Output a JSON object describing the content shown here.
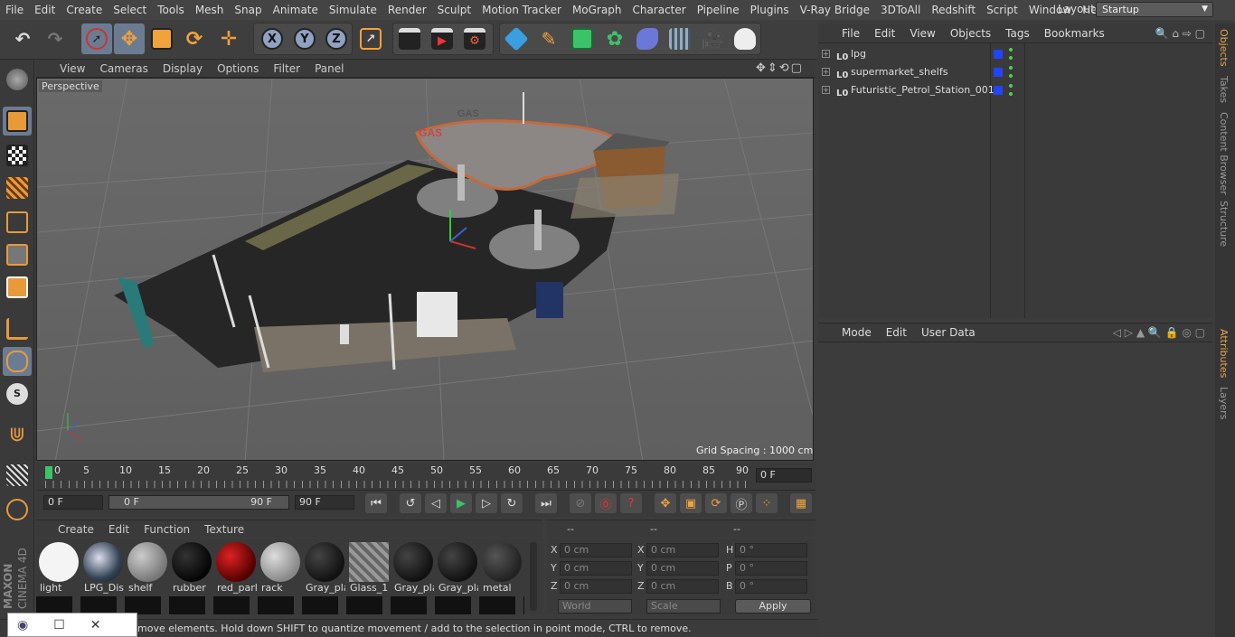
{
  "menubar": {
    "items": [
      "File",
      "Edit",
      "Create",
      "Select",
      "Tools",
      "Mesh",
      "Snap",
      "Animate",
      "Simulate",
      "Render",
      "Sculpt",
      "Motion Tracker",
      "MoGraph",
      "Character",
      "Pipeline",
      "Plugins",
      "V-Ray Bridge",
      "3DToAll",
      "Redshift",
      "Script",
      "Window",
      "Help"
    ],
    "layout_label": "Layout:",
    "layout_value": "Startup"
  },
  "viewport": {
    "menu": [
      "View",
      "Cameras",
      "Display",
      "Options",
      "Filter",
      "Panel"
    ],
    "label": "Perspective",
    "grid_spacing": "Grid Spacing : 1000 cm",
    "scene_text": "GAS"
  },
  "timeline": {
    "ticks": [
      "0",
      "5",
      "10",
      "15",
      "20",
      "25",
      "30",
      "35",
      "40",
      "45",
      "50",
      "55",
      "60",
      "65",
      "70",
      "75",
      "80",
      "85",
      "90"
    ],
    "current_frame": "0 F"
  },
  "transport": {
    "start": "0 F",
    "range_start": "0 F",
    "range_end": "90 F",
    "end": "90 F"
  },
  "materials": {
    "menu": [
      "Create",
      "Edit",
      "Function",
      "Texture"
    ],
    "items": [
      {
        "name": "light",
        "color": "#f4f4f4"
      },
      {
        "name": "LPG_Dis",
        "color": "#6c7a8a"
      },
      {
        "name": "shelf",
        "color": "#9a9a9a"
      },
      {
        "name": "rubber",
        "color": "#0e0e0e"
      },
      {
        "name": "red_parl",
        "color": "#8a0a0a"
      },
      {
        "name": "rack",
        "color": "#a4a4a4"
      },
      {
        "name": "Gray_pla",
        "color": "#1c1c1c"
      },
      {
        "name": "Glass_1",
        "color": "#8a8a8a"
      },
      {
        "name": "Gray_pla",
        "color": "#222222"
      },
      {
        "name": "Gray_pla",
        "color": "#1e1e1e"
      },
      {
        "name": "metal",
        "color": "#3a3a3a"
      }
    ]
  },
  "coords": {
    "headers": [
      "--",
      "--",
      "--"
    ],
    "rows": [
      {
        "l1": "X",
        "v1": "0 cm",
        "l2": "X",
        "v2": "0 cm",
        "l3": "H",
        "v3": "0 °"
      },
      {
        "l1": "Y",
        "v1": "0 cm",
        "l2": "Y",
        "v2": "0 cm",
        "l3": "P",
        "v3": "0 °"
      },
      {
        "l1": "Z",
        "v1": "0 cm",
        "l2": "Z",
        "v2": "0 cm",
        "l3": "B",
        "v3": "0 °"
      }
    ],
    "world": "World",
    "scale": "Scale",
    "apply": "Apply"
  },
  "status": {
    "text": "move elements. Hold down SHIFT to quantize movement / add to the selection in point mode, CTRL to remove."
  },
  "objects_panel": {
    "menu": [
      "File",
      "Edit",
      "View",
      "Objects",
      "Tags",
      "Bookmarks"
    ],
    "items": [
      "lpg",
      "supermarket_shelfs",
      "Futuristic_Petrol_Station_001"
    ]
  },
  "attributes_panel": {
    "menu": [
      "Mode",
      "Edit",
      "User Data"
    ]
  },
  "right_tabs": [
    "Objects",
    "Takes",
    "Content Browser",
    "Structure",
    "Attributes",
    "Layers"
  ],
  "brand": {
    "line1": "MAXON",
    "line2": "CINEMA 4D"
  },
  "colors": {
    "accent": "#6b7c92",
    "swatch": "#2244ff",
    "visible_dot": "#4fd14f",
    "active_tab": "#e8a64a"
  }
}
